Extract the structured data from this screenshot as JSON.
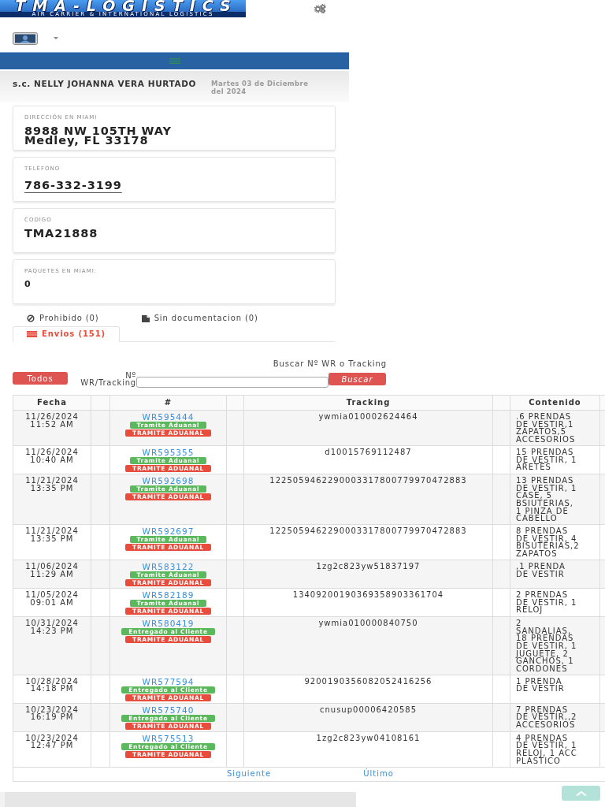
{
  "header": {
    "logo_title": "TMA-LOGISTICS",
    "logo_tagline": "AIR CARRIER & INTERNATIONAL LOGISTICS"
  },
  "user": {
    "name": "s.c. NELLY JOHANNA VERA HURTADO",
    "date": "Martes 03 de Diciembre del 2024"
  },
  "info_cards": [
    {
      "kind": "address",
      "label": "DIRECCIÓN EN MIAMI",
      "value": "8988 NW 105TH WAY\nMedley, FL 33178"
    },
    {
      "kind": "phone",
      "label": "TELÉFONO",
      "value": "786-332-3199"
    },
    {
      "kind": "code",
      "label": "CODIGO",
      "value": "TMA21888"
    },
    {
      "kind": "count",
      "label": "PAQUETES EN MIAMI:",
      "value": "0"
    }
  ],
  "tabs": [
    {
      "kind": "prohibited",
      "label": "Prohibido (0)",
      "selected": false
    },
    {
      "kind": "undocumented",
      "label": "Sin documentacion (0)",
      "selected": false
    },
    {
      "kind": "shipments",
      "label": "Envios (151)",
      "selected": true
    }
  ],
  "search": {
    "title": "Buscar Nº WR o Tracking",
    "all_button": "Todos",
    "field_label": "Nº WR/Tracking",
    "search_button": "Buscar"
  },
  "table": {
    "columns": [
      "Fecha",
      "#",
      "Tracking",
      "Contenido"
    ],
    "rows": [
      {
        "fecha": "11/26/2024 11:52 AM",
        "wr": "WR595444",
        "statuses": [
          {
            "text": "Tramite Aduanal",
            "color": "#5cb85c"
          },
          {
            "text": "TRAMITE ADUANAL",
            "color": "#e74c3c"
          }
        ],
        "tracking": "ywmia010002624464",
        "contenido": ".6 PRENDAS DE VESTIR,1 ZAPATOS,5 ACCESORIOS"
      },
      {
        "fecha": "11/26/2024 10:40 AM",
        "wr": "WR595355",
        "statuses": [
          {
            "text": "Tramite Aduanal",
            "color": "#5cb85c"
          },
          {
            "text": "TRAMITE ADUANAL",
            "color": "#e74c3c"
          }
        ],
        "tracking": "d10015769112487",
        "contenido": "15 PRENDAS DE VESTIR, 1 ARETES"
      },
      {
        "fecha": "11/21/2024 13:35 PM",
        "wr": "WR592698",
        "statuses": [
          {
            "text": "Tramite Aduanal",
            "color": "#5cb85c"
          },
          {
            "text": "TRAMITE ADUANAL",
            "color": "#e74c3c"
          }
        ],
        "tracking": "1225059462290003317800779970472883",
        "contenido": "13 PRENDAS DE VESTIR, 1 CASE, 5 BSIUTERIAS, 1 PINZA DE CABELLO"
      },
      {
        "fecha": "11/21/2024 13:35 PM",
        "wr": "WR592697",
        "statuses": [
          {
            "text": "Tramite Aduanal",
            "color": "#5cb85c"
          },
          {
            "text": "TRAMITE ADUANAL",
            "color": "#e74c3c"
          }
        ],
        "tracking": "1225059462290003317800779970472883",
        "contenido": "8 PRENDAS DE VESTIR, 4 BISUTERIAS,2 ZAPATOS"
      },
      {
        "fecha": "11/06/2024 11:29 AM",
        "wr": "WR583122",
        "statuses": [
          {
            "text": "Tramite Aduanal",
            "color": "#5cb85c"
          },
          {
            "text": "TRAMITE ADUANAL",
            "color": "#e74c3c"
          }
        ],
        "tracking": "1zg2c823yw51837197",
        "contenido": ",1 PRENDA DE VESTIR"
      },
      {
        "fecha": "11/05/2024 09:01 AM",
        "wr": "WR582189",
        "statuses": [
          {
            "text": "Tramite Aduanal",
            "color": "#5cb85c"
          },
          {
            "text": "TRAMITE ADUANAL",
            "color": "#e74c3c"
          }
        ],
        "tracking": "13409200190369358903361704",
        "contenido": "2 PRENDAS DE VESTIR, 1 RELOJ"
      },
      {
        "fecha": "10/31/2024 14:23 PM",
        "wr": "WR580419",
        "statuses": [
          {
            "text": "Entregado al Cliente",
            "color": "#5cb85c"
          },
          {
            "text": "TRAMITE ADUANAL",
            "color": "#e74c3c"
          }
        ],
        "tracking": "ywmia010000840750",
        "contenido": "2 SANDALIAS, 18 PRENDAS DE VESTIR, 1 JUGUETE, 2 GANCHOS, 1 CORDONES"
      },
      {
        "fecha": "10/28/2024 14:18 PM",
        "wr": "WR577594",
        "statuses": [
          {
            "text": "Entregado al Cliente",
            "color": "#5cb85c"
          },
          {
            "text": "TRAMITE ADUANAL",
            "color": "#e74c3c"
          }
        ],
        "tracking": "9200190356082052416256",
        "contenido": "1 PRENDA DE VESTIR"
      },
      {
        "fecha": "10/23/2024 16:19 PM",
        "wr": "WR575740",
        "statuses": [
          {
            "text": "Entregado al Cliente",
            "color": "#5cb85c"
          },
          {
            "text": "TRAMITE ADUANAL",
            "color": "#e74c3c"
          }
        ],
        "tracking": "cnusup00006420585",
        "contenido": "7 PRENDAS DE VESTIR,,2 ACCESORIOS"
      },
      {
        "fecha": "10/23/2024 12:47 PM",
        "wr": "WR575513",
        "statuses": [
          {
            "text": "Entregado al Cliente",
            "color": "#5cb85c"
          },
          {
            "text": "TRAMITE ADUANAL",
            "color": "#e74c3c"
          }
        ],
        "tracking": "1zg2c823yw04108161",
        "contenido": "4 PRENDAS DE VESTIR, 1 RELOJ, 1 ACC PLASTICO"
      }
    ]
  },
  "pagination": [
    "Siguiente",
    "Último"
  ]
}
